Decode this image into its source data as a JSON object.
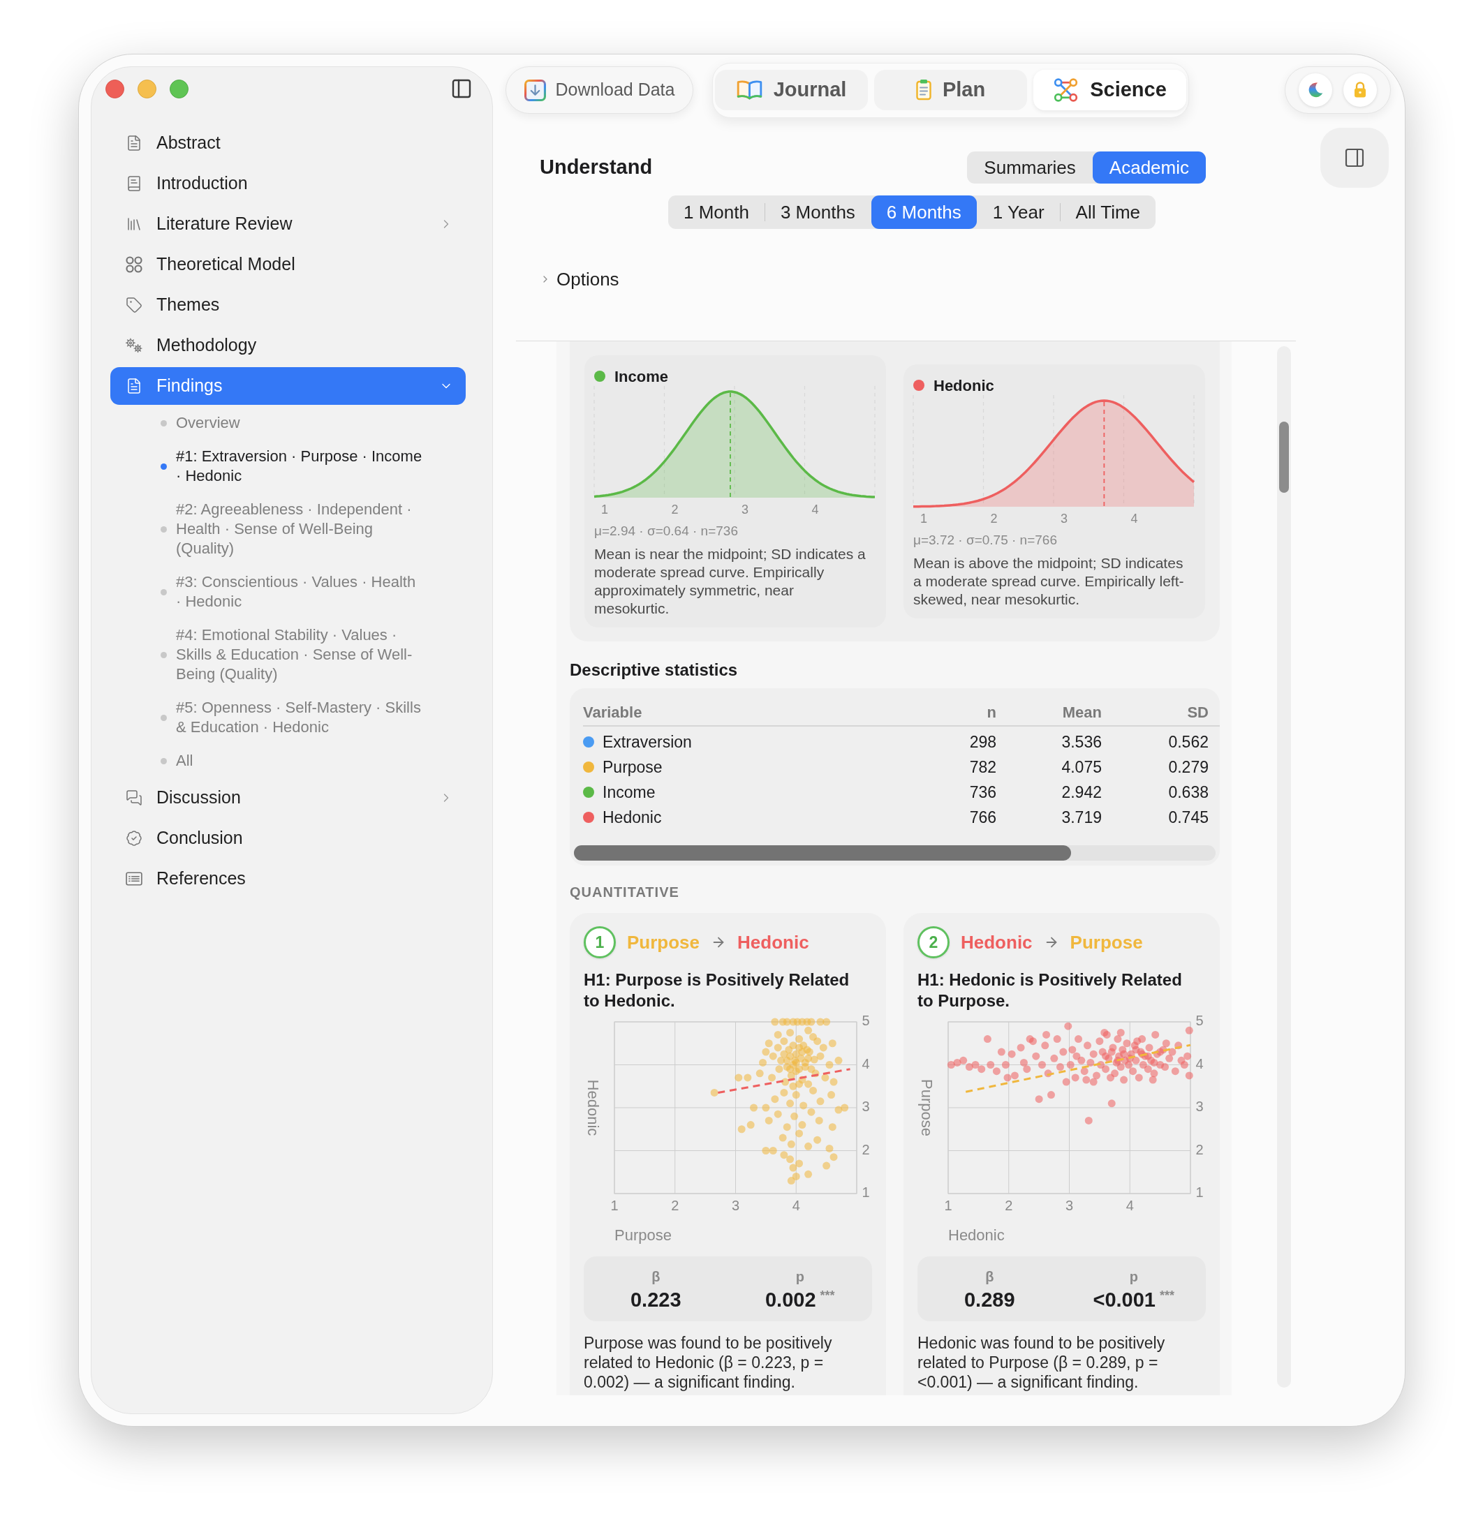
{
  "sidebar": {
    "items": [
      {
        "label": "Abstract",
        "selected": false
      },
      {
        "label": "Introduction",
        "selected": false
      },
      {
        "label": "Literature Review",
        "selected": false,
        "expanded": false
      },
      {
        "label": "Theoretical Model",
        "selected": false
      },
      {
        "label": "Themes",
        "selected": false
      },
      {
        "label": "Methodology",
        "selected": false
      },
      {
        "label": "Findings",
        "selected": true,
        "expanded": true,
        "children": [
          {
            "label": "Overview",
            "selected": false
          },
          {
            "label": "#1: Extraversion · Purpose · Income · Hedonic",
            "selected": true
          },
          {
            "label": "#2: Agreeableness · Independent · Health · Sense of Well-Being (Quality)",
            "selected": false
          },
          {
            "label": "#3: Conscientious · Values · Health · Hedonic",
            "selected": false
          },
          {
            "label": "#4: Emotional Stability · Values · Skills & Education · Sense of Well-Being (Quality)",
            "selected": false
          },
          {
            "label": "#5: Openness · Self-Mastery · Skills & Education · Hedonic",
            "selected": false
          },
          {
            "label": "All",
            "selected": false
          }
        ]
      },
      {
        "label": "Discussion",
        "selected": false,
        "expanded": false
      },
      {
        "label": "Conclusion",
        "selected": false
      },
      {
        "label": "References",
        "selected": false
      }
    ]
  },
  "toolbar": {
    "download_button": {
      "label": "Download Data"
    },
    "tabs": [
      {
        "label": "Journal",
        "selected": false
      },
      {
        "label": "Plan",
        "selected": false
      },
      {
        "label": "Science",
        "selected": true
      }
    ]
  },
  "header": {
    "title": "Understand",
    "modes": [
      {
        "label": "Summaries",
        "selected": false
      },
      {
        "label": "Academic",
        "selected": true
      }
    ],
    "ranges": [
      {
        "label": "1 Month",
        "selected": false
      },
      {
        "label": "3 Months",
        "selected": false
      },
      {
        "label": "6 Months",
        "selected": true
      },
      {
        "label": "1 Year",
        "selected": false
      },
      {
        "label": "All Time",
        "selected": false
      }
    ],
    "options": {
      "label": "Options",
      "expanded": false
    }
  },
  "distributions": [
    {
      "name": "Income",
      "color": "#5bb947",
      "ticks": [
        "1",
        "2",
        "3",
        "4"
      ],
      "stats": "μ=2.94 · σ=0.64 · n=736",
      "description": "Mean is near the midpoint; SD indicates a moderate spread curve. Empirically approximately symmetric, near mesokurtic."
    },
    {
      "name": "Hedonic",
      "color": "#ee5f5f",
      "ticks": [
        "1",
        "2",
        "3",
        "4"
      ],
      "stats": "μ=3.72 · σ=0.75 · n=766",
      "description": "Mean is above the midpoint; SD indicates a moderate spread curve. Empirically left-skewed, near mesokurtic."
    }
  ],
  "descriptive_statistics": {
    "title": "Descriptive statistics",
    "columns": [
      "Variable",
      "n",
      "Mean",
      "SD"
    ],
    "rows": [
      {
        "variable": "Extraversion",
        "color": "#4a9bf2",
        "n": "298",
        "mean": "3.536",
        "sd": "0.562"
      },
      {
        "variable": "Purpose",
        "color": "#f0b73d",
        "n": "782",
        "mean": "4.075",
        "sd": "0.279"
      },
      {
        "variable": "Income",
        "color": "#5bb947",
        "n": "736",
        "mean": "2.942",
        "sd": "0.638"
      },
      {
        "variable": "Hedonic",
        "color": "#ee5f5f",
        "n": "766",
        "mean": "3.719",
        "sd": "0.745"
      }
    ]
  },
  "quantitative": {
    "title": "QUANTITATIVE",
    "hypotheses": [
      {
        "number": "1",
        "from": {
          "label": "Purpose",
          "color": "#f0b73d"
        },
        "to": {
          "label": "Hedonic",
          "color": "#ee5f5f"
        },
        "title": "H1: Purpose is Positively Related to Hedonic.",
        "chart_data": {
          "type": "scatter",
          "xlabel": "Purpose",
          "ylabel": "Hedonic",
          "xlim": [
            1,
            5
          ],
          "ylim": [
            1,
            5
          ],
          "xticks": [
            1,
            2,
            3,
            4
          ],
          "yticks": [
            1,
            2,
            3,
            4,
            5
          ],
          "grid": true,
          "x": [
            2.71,
            4.89,
            3.65,
            3.78,
            3.85,
            3.95,
            4.02,
            4.1,
            4.18,
            4.25,
            4.4,
            4.5,
            3.7,
            3.9,
            4.05,
            4.2,
            4.35,
            3.55,
            4.6,
            3.8,
            4.12,
            4.28,
            3.5,
            3.62,
            3.75,
            3.88,
            3.95,
            4.0,
            4.08,
            4.15,
            4.22,
            4.3,
            4.4,
            4.55,
            4.7,
            3.45,
            3.85,
            4.05,
            3.98,
            4.18,
            3.7,
            4.45,
            3.4,
            3.6,
            3.72,
            3.82,
            3.92,
            4.0,
            4.1,
            4.2,
            4.32,
            4.48,
            4.62,
            3.2,
            3.95,
            4.25,
            4.05,
            3.5,
            3.65,
            3.8,
            3.9,
            4.0,
            4.12,
            4.28,
            4.4,
            4.58,
            4.8,
            3.3,
            4.7,
            3.55,
            3.7,
            3.85,
            3.97,
            4.1,
            4.25,
            4.38,
            4.6,
            3.1,
            3.25,
            3.5,
            3.62,
            3.78,
            3.92,
            4.05,
            4.2,
            4.35,
            4.55,
            3.9,
            3.95,
            4.0,
            3.92,
            4.05,
            4.2,
            3.8,
            4.5,
            4.62,
            2.65,
            3.05,
            3.9,
            4.0,
            4.1,
            3.95,
            4.15,
            3.85,
            4.05,
            3.9,
            4.2,
            3.8
          ],
          "series": [
            {
              "color": "#f0b73d",
              "values": [
                null,
                null,
                5,
                5,
                5,
                5,
                5,
                5,
                5,
                5,
                5,
                5,
                4.7,
                4.75,
                4.6,
                4.8,
                4.55,
                4.5,
                4.5,
                4.55,
                4.45,
                4.65,
                4.3,
                4.2,
                4.1,
                4.35,
                4.0,
                4.25,
                4.15,
                4.05,
                4.3,
                4.12,
                4.2,
                4.0,
                4.1,
                4.05,
                3.95,
                4.4,
                4.1,
                4.35,
                4.4,
                4.4,
                3.8,
                3.7,
                3.9,
                3.6,
                3.75,
                3.85,
                3.65,
                3.55,
                3.8,
                3.7,
                3.6,
                3.7,
                3.5,
                3.9,
                3.55,
                3.0,
                3.2,
                3.35,
                3.1,
                3.3,
                3.05,
                3.4,
                3.15,
                3.3,
                3.0,
                3.0,
                2.95,
                2.7,
                2.85,
                2.55,
                2.8,
                2.6,
                2.9,
                2.7,
                2.55,
                2.5,
                2.6,
                2.0,
                2.0,
                2.3,
                2.15,
                2.4,
                2.1,
                2.25,
                2.05,
                1.8,
                1.6,
                1.4,
                1.3,
                1.7,
                1.45,
                1.9,
                1.65,
                1.85,
                3.35,
                3.7,
                4.2,
                4.05,
                4.3,
                4.45,
                3.95,
                4.1,
                3.9,
                3.9,
                4.15,
                4.25
              ]
            },
            {
              "type": "line",
              "line_style": "dashed",
              "color": "#ee5f5f",
              "values": [
                3.35,
                3.9,
                null,
                null,
                null,
                null,
                null,
                null,
                null,
                null,
                null,
                null,
                null,
                null,
                null,
                null,
                null,
                null,
                null,
                null,
                null,
                null,
                null,
                null,
                null,
                null,
                null,
                null,
                null,
                null,
                null,
                null,
                null,
                null,
                null,
                null,
                null,
                null,
                null,
                null,
                null,
                null,
                null,
                null,
                null,
                null,
                null,
                null,
                null,
                null,
                null,
                null,
                null,
                null,
                null,
                null,
                null,
                null,
                null,
                null,
                null,
                null,
                null,
                null,
                null,
                null,
                null,
                null,
                null,
                null,
                null,
                null,
                null,
                null,
                null,
                null,
                null,
                null,
                null,
                null,
                null,
                null,
                null,
                null,
                null,
                null,
                null,
                null,
                null,
                null,
                null,
                null,
                null,
                null,
                null,
                null,
                null,
                null,
                null,
                null,
                null,
                null,
                null,
                null,
                null,
                null,
                null,
                null
              ]
            }
          ]
        },
        "stats": [
          {
            "label": "β",
            "value": "0.223"
          },
          {
            "label": "p",
            "value": "0.002",
            "significance": "***"
          }
        ],
        "summary": "Purpose was found to be positively related to Hedonic (β = 0.223, p = 0.002) — a significant finding."
      },
      {
        "number": "2",
        "from": {
          "label": "Hedonic",
          "color": "#ee5f5f"
        },
        "to": {
          "label": "Purpose",
          "color": "#f0b73d"
        },
        "title": "H1: Hedonic is Positively Related to Purpose.",
        "chart_data": {
          "type": "scatter",
          "xlabel": "Hedonic",
          "ylabel": "Purpose",
          "xlim": [
            1,
            5
          ],
          "ylim": [
            1,
            5
          ],
          "xticks": [
            1,
            2,
            3,
            4
          ],
          "yticks": [
            1,
            2,
            3,
            4,
            5
          ],
          "grid": true,
          "x": [
            1.29,
            5.0,
            1.05,
            1.15,
            1.25,
            1.35,
            1.45,
            1.55,
            1.65,
            1.7,
            1.8,
            1.88,
            1.95,
            1.98,
            2.05,
            2.1,
            2.2,
            2.25,
            2.3,
            2.4,
            2.45,
            2.5,
            2.55,
            2.6,
            2.65,
            2.7,
            2.75,
            2.8,
            2.85,
            2.9,
            2.95,
            2.98,
            2.35,
            2.62,
            3.02,
            3.05,
            3.1,
            3.15,
            3.2,
            3.25,
            3.3,
            3.32,
            3.35,
            3.4,
            3.45,
            3.5,
            3.52,
            3.55,
            3.6,
            3.62,
            3.65,
            3.7,
            3.72,
            3.75,
            3.78,
            3.8,
            3.82,
            3.85,
            3.88,
            3.9,
            3.92,
            3.95,
            3.98,
            3.4,
            3.58,
            3.68,
            3.12,
            3.28,
            3.85,
            4.02,
            4.05,
            4.08,
            4.1,
            4.15,
            4.18,
            4.2,
            4.22,
            4.25,
            4.3,
            4.32,
            4.35,
            4.4,
            4.42,
            4.45,
            4.5,
            4.55,
            4.58,
            4.6,
            4.65,
            4.7,
            4.75,
            4.8,
            4.85,
            4.9,
            4.95,
            4.98,
            4.98,
            4.12,
            4.38,
            3.6,
            3.8,
            4.0,
            4.2,
            4.4,
            3.7,
            3.9,
            4.1,
            4.3,
            4.5
          ],
          "series": [
            {
              "color": "#ee5f5f",
              "values": [
                null,
                null,
                4.0,
                4.05,
                4.1,
                3.95,
                4.0,
                3.9,
                4.6,
                4.0,
                3.85,
                4.3,
                4.0,
                3.7,
                4.25,
                3.75,
                4.4,
                4.05,
                3.9,
                4.55,
                4.2,
                3.2,
                4.0,
                4.45,
                3.8,
                3.3,
                4.15,
                4.6,
                3.95,
                4.3,
                3.6,
                4.9,
                4.6,
                4.7,
                4.0,
                4.35,
                3.7,
                4.6,
                4.1,
                3.85,
                4.45,
                2.7,
                4.05,
                4.25,
                3.75,
                4.55,
                4.0,
                4.3,
                3.9,
                4.7,
                4.15,
                3.1,
                4.4,
                3.8,
                4.05,
                4.6,
                4.2,
                3.95,
                4.35,
                3.65,
                4.1,
                4.5,
                4.0,
                3.6,
                4.75,
                3.7,
                4.2,
                3.65,
                4.75,
                4.25,
                3.85,
                4.45,
                4.1,
                3.7,
                4.3,
                4.6,
                4.0,
                4.2,
                3.9,
                4.4,
                4.1,
                3.8,
                4.7,
                4.25,
                4.0,
                4.35,
                3.95,
                4.5,
                4.15,
                4.3,
                3.85,
                4.45,
                4.1,
                4.0,
                4.2,
                4.8,
                3.75,
                4.55,
                3.65,
                4.2,
                4.1,
                4.15,
                4.25,
                4.05,
                4.3,
                4.25,
                4.35,
                4.2,
                4.3
              ]
            },
            {
              "type": "line",
              "line_style": "dashed",
              "color": "#f0b73d",
              "values": [
                3.37,
                4.46,
                null,
                null,
                null,
                null,
                null,
                null,
                null,
                null,
                null,
                null,
                null,
                null,
                null,
                null,
                null,
                null,
                null,
                null,
                null,
                null,
                null,
                null,
                null,
                null,
                null,
                null,
                null,
                null,
                null,
                null,
                null,
                null,
                null,
                null,
                null,
                null,
                null,
                null,
                null,
                null,
                null,
                null,
                null,
                null,
                null,
                null,
                null,
                null,
                null,
                null,
                null,
                null,
                null,
                null,
                null,
                null,
                null,
                null,
                null,
                null,
                null,
                null,
                null,
                null,
                null,
                null,
                null,
                null,
                null,
                null,
                null,
                null,
                null,
                null,
                null,
                null,
                null,
                null,
                null,
                null,
                null,
                null,
                null,
                null,
                null,
                null,
                null,
                null,
                null,
                null,
                null,
                null,
                null,
                null,
                null,
                null,
                null,
                null,
                null,
                null,
                null,
                null,
                null,
                null,
                null,
                null,
                null
              ]
            }
          ]
        },
        "stats": [
          {
            "label": "β",
            "value": "0.289"
          },
          {
            "label": "p",
            "value": "<0.001",
            "significance": "***"
          }
        ],
        "summary": "Hedonic was found to be positively related to Purpose (β = 0.289, p = <0.001) — a significant finding."
      }
    ]
  }
}
